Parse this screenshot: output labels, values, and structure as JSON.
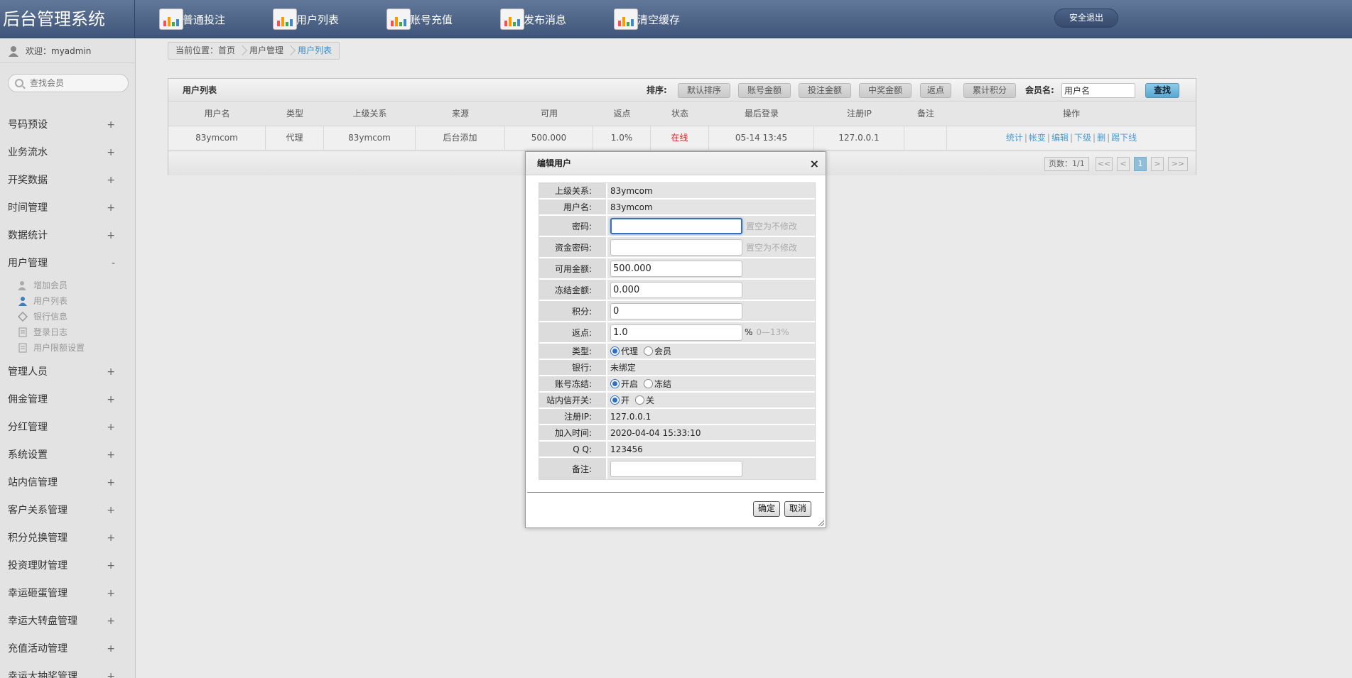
{
  "app": {
    "title": "后台管理系统"
  },
  "topnav": {
    "items": [
      {
        "label": "普通投注",
        "icon": "chart-icon"
      },
      {
        "label": "用户列表",
        "icon": "chart-icon"
      },
      {
        "label": "账号充值",
        "icon": "chart-icon"
      },
      {
        "label": "发布消息",
        "icon": "chart-icon"
      },
      {
        "label": "清空缓存",
        "icon": "chart-icon"
      }
    ],
    "logout": "安全退出"
  },
  "sidebar": {
    "welcome": "欢迎：myadmin",
    "search_placeholder": "查找会员",
    "menu": [
      {
        "label": "号码预设",
        "sign": "+"
      },
      {
        "label": "业务流水",
        "sign": "+"
      },
      {
        "label": "开奖数据",
        "sign": "+"
      },
      {
        "label": "时间管理",
        "sign": "+"
      },
      {
        "label": "数据统计",
        "sign": "+"
      },
      {
        "label": "用户管理",
        "sign": "-"
      },
      {
        "label": "管理人员",
        "sign": "+"
      },
      {
        "label": "佣金管理",
        "sign": "+"
      },
      {
        "label": "分红管理",
        "sign": "+"
      },
      {
        "label": "系统设置",
        "sign": "+"
      },
      {
        "label": "站内信管理",
        "sign": "+"
      },
      {
        "label": "客户关系管理",
        "sign": "+"
      },
      {
        "label": "积分兑换管理",
        "sign": "+"
      },
      {
        "label": "投资理财管理",
        "sign": "+"
      },
      {
        "label": "幸运砸蛋管理",
        "sign": "+"
      },
      {
        "label": "幸运大转盘管理",
        "sign": "+"
      },
      {
        "label": "充值活动管理",
        "sign": "+"
      },
      {
        "label": "幸运大抽奖管理",
        "sign": "+"
      }
    ],
    "submenu": [
      {
        "label": "增加会员",
        "icon": "add-user-icon"
      },
      {
        "label": "用户列表",
        "icon": "user-icon"
      },
      {
        "label": "银行信息",
        "icon": "diamond-icon"
      },
      {
        "label": "登录日志",
        "icon": "log-icon"
      },
      {
        "label": "用户限额设置",
        "icon": "log-icon"
      }
    ]
  },
  "breadcrumb": {
    "items": [
      "当前位置：首页",
      "用户管理",
      "用户列表"
    ]
  },
  "panel": {
    "title": "用户列表",
    "sort_label": "排序:",
    "sort_buttons": [
      "默认排序",
      "账号金额",
      "投注金额",
      "中奖金额",
      "返点",
      "累计积分"
    ],
    "member_label": "会员名:",
    "member_value": "用户名",
    "find_button": "查找",
    "columns": [
      "用户名",
      "类型",
      "上级关系",
      "来源",
      "可用",
      "返点",
      "状态",
      "最后登录",
      "注册IP",
      "备注",
      "操作"
    ],
    "rows": [
      {
        "username": "83ymcom",
        "type": "代理",
        "parent": "83ymcom",
        "source": "后台添加",
        "balance": "500.000",
        "rebate": "1.0%",
        "status": "在线",
        "last_login": "05-14 13:45",
        "ip": "127.0.0.1",
        "note": ""
      }
    ],
    "ops": [
      "统计",
      "帐变",
      "编辑",
      "下级",
      "删",
      "踢下线"
    ],
    "pager": {
      "info": "页数：1/1",
      "first": "<<",
      "prev": "<",
      "current": "1",
      "next": ">",
      "last": ">>"
    }
  },
  "dialog": {
    "title": "编辑用户",
    "close": "×",
    "fields": {
      "parent": {
        "label": "上级关系:",
        "value": "83ymcom"
      },
      "username": {
        "label": "用户名:",
        "value": "83ymcom"
      },
      "password": {
        "label": "密码:",
        "value": "",
        "hint": "置空为不修改"
      },
      "fund_password": {
        "label": "资金密码:",
        "value": "",
        "hint": "置空为不修改"
      },
      "balance": {
        "label": "可用金额:",
        "value": "500.000"
      },
      "frozen": {
        "label": "冻结金额:",
        "value": "0.000"
      },
      "points": {
        "label": "积分:",
        "value": "0"
      },
      "rebate": {
        "label": "返点:",
        "value": "1.0",
        "unit": "%",
        "range": "0—13%"
      },
      "type": {
        "label": "类型:",
        "opt1": "代理",
        "opt2": "会员"
      },
      "bank": {
        "label": "银行:",
        "value": "未绑定"
      },
      "freeze": {
        "label": "账号冻结:",
        "opt1": "开启",
        "opt2": "冻结"
      },
      "mail": {
        "label": "站内信开关:",
        "opt1": "开",
        "opt2": "关"
      },
      "reg_ip": {
        "label": "注册IP:",
        "value": "127.0.0.1"
      },
      "join_time": {
        "label": "加入时间:",
        "value": "2020-04-04 15:33:10"
      },
      "qq": {
        "label": "Q Q:",
        "value": "123456"
      },
      "note": {
        "label": "备注:",
        "value": ""
      }
    },
    "ok": "确定",
    "cancel": "取消"
  }
}
